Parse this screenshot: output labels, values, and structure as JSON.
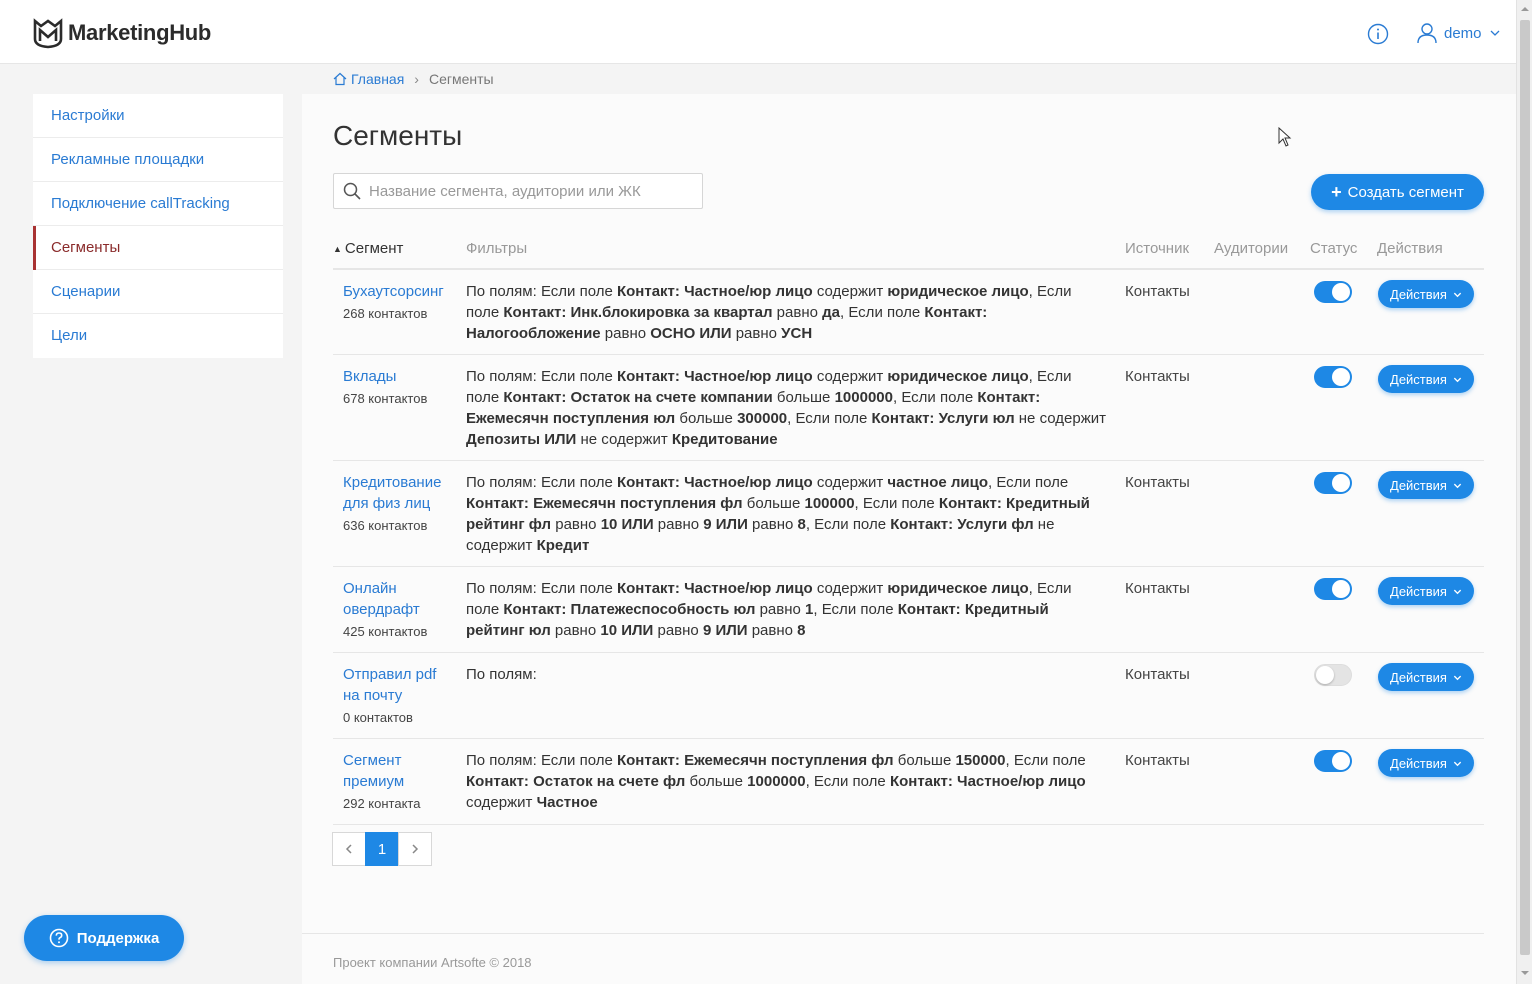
{
  "header": {
    "app_name": "MarketingHub",
    "user": "demo"
  },
  "breadcrumb": {
    "home": "Главная",
    "current": "Сегменты"
  },
  "sidebar": {
    "items": [
      {
        "label": "Настройки"
      },
      {
        "label": "Рекламные площадки"
      },
      {
        "label": "Подключение callTracking"
      },
      {
        "label": "Сегменты"
      },
      {
        "label": "Сценарии"
      },
      {
        "label": "Цели"
      }
    ],
    "active_index": 3
  },
  "support": {
    "label": "Поддержка"
  },
  "page": {
    "title": "Сегменты",
    "search_placeholder": "Название сегмента, аудитории или ЖК",
    "create_label": "Создать сегмент"
  },
  "table": {
    "columns": {
      "segment": "Сегмент",
      "filters": "Фильтры",
      "source": "Источник",
      "audiences": "Аудитории",
      "status": "Статус",
      "actions": "Действия"
    },
    "action_label": "Действия",
    "rows": [
      {
        "name": "Бухаутсорсинг",
        "count": "268 контактов",
        "filter_parts": [
          [
            "По полям: Если поле ",
            false
          ],
          [
            "Контакт: Частное/юр лицо",
            true
          ],
          [
            " содержит ",
            false
          ],
          [
            "юридическое лицо",
            true
          ],
          [
            ", Если поле ",
            false
          ],
          [
            "Контакт: Инк.блокировка за квартал",
            true
          ],
          [
            " равно ",
            false
          ],
          [
            "да",
            true
          ],
          [
            ", Если поле ",
            false
          ],
          [
            "Контакт: Налогообложение",
            true
          ],
          [
            " равно ",
            false
          ],
          [
            "ОСНО ИЛИ",
            true
          ],
          [
            " равно ",
            false
          ],
          [
            "УСН",
            true
          ]
        ],
        "source": "Контакты",
        "status_on": true
      },
      {
        "name": "Вклады",
        "count": "678 контактов",
        "filter_parts": [
          [
            "По полям: Если поле ",
            false
          ],
          [
            "Контакт: Частное/юр лицо",
            true
          ],
          [
            " содержит ",
            false
          ],
          [
            "юридическое лицо",
            true
          ],
          [
            ", Если поле ",
            false
          ],
          [
            "Контакт: Остаток на счете компании",
            true
          ],
          [
            " больше ",
            false
          ],
          [
            "1000000",
            true
          ],
          [
            ", Если поле ",
            false
          ],
          [
            "Контакт: Ежемесячн поступления юл",
            true
          ],
          [
            " больше ",
            false
          ],
          [
            "300000",
            true
          ],
          [
            ", Если поле ",
            false
          ],
          [
            "Контакт: Услуги юл",
            true
          ],
          [
            " не содержит ",
            false
          ],
          [
            "Депозиты ИЛИ",
            true
          ],
          [
            " не содержит ",
            false
          ],
          [
            "Кредитование",
            true
          ]
        ],
        "source": "Контакты",
        "status_on": true
      },
      {
        "name": "Кредитование для физ лиц",
        "count": "636 контактов",
        "filter_parts": [
          [
            "По полям: Если поле ",
            false
          ],
          [
            "Контакт: Частное/юр лицо",
            true
          ],
          [
            " содержит ",
            false
          ],
          [
            "частное лицо",
            true
          ],
          [
            ", Если поле ",
            false
          ],
          [
            "Контакт: Ежемесячн поступления фл",
            true
          ],
          [
            " больше ",
            false
          ],
          [
            "100000",
            true
          ],
          [
            ", Если поле ",
            false
          ],
          [
            "Контакт: Кредитный рейтинг фл",
            true
          ],
          [
            " равно ",
            false
          ],
          [
            "10 ИЛИ",
            true
          ],
          [
            " равно ",
            false
          ],
          [
            "9 ИЛИ",
            true
          ],
          [
            " равно ",
            false
          ],
          [
            "8",
            true
          ],
          [
            ", Если поле ",
            false
          ],
          [
            "Контакт: Услуги фл",
            true
          ],
          [
            " не содержит ",
            false
          ],
          [
            "Кредит",
            true
          ]
        ],
        "source": "Контакты",
        "status_on": true
      },
      {
        "name": "Онлайн овердрафт",
        "count": "425 контактов",
        "filter_parts": [
          [
            "По полям: Если поле ",
            false
          ],
          [
            "Контакт: Частное/юр лицо",
            true
          ],
          [
            " содержит ",
            false
          ],
          [
            "юридическое лицо",
            true
          ],
          [
            ", Если поле ",
            false
          ],
          [
            "Контакт: Платежеспособность юл",
            true
          ],
          [
            " равно ",
            false
          ],
          [
            "1",
            true
          ],
          [
            ", Если поле ",
            false
          ],
          [
            "Контакт: Кредитный рейтинг юл",
            true
          ],
          [
            " равно ",
            false
          ],
          [
            "10 ИЛИ",
            true
          ],
          [
            " равно ",
            false
          ],
          [
            "9 ИЛИ",
            true
          ],
          [
            " равно ",
            false
          ],
          [
            "8",
            true
          ]
        ],
        "source": "Контакты",
        "status_on": true
      },
      {
        "name": "Отправил pdf на почту",
        "count": "0 контактов",
        "filter_parts": [
          [
            "По полям:",
            false
          ]
        ],
        "source": "Контакты",
        "status_on": false
      },
      {
        "name": "Сегмент премиум",
        "count": "292 контакта",
        "filter_parts": [
          [
            "По полям: Если поле ",
            false
          ],
          [
            "Контакт: Ежемесячн поступления фл",
            true
          ],
          [
            " больше ",
            false
          ],
          [
            "150000",
            true
          ],
          [
            ", Если поле ",
            false
          ],
          [
            "Контакт: Остаток на счете фл",
            true
          ],
          [
            " больше ",
            false
          ],
          [
            "1000000",
            true
          ],
          [
            ", Если поле ",
            false
          ],
          [
            "Контакт: Частное/юр лицо",
            true
          ],
          [
            " содержит ",
            false
          ],
          [
            "Частное",
            true
          ]
        ],
        "source": "Контакты",
        "status_on": true
      }
    ]
  },
  "pagination": {
    "current": "1"
  },
  "footer": {
    "text": "Проект компании Artsofte © 2018"
  },
  "colors": {
    "accent": "#1e88e5",
    "link": "#2a7bd3",
    "active_marker": "#a83232"
  },
  "icons": [
    "marketinghub-logo-icon",
    "info-icon",
    "user-icon",
    "chevron-down-icon",
    "home-icon",
    "search-icon",
    "plus-icon",
    "question-icon",
    "chevron-left-icon",
    "chevron-right-icon"
  ]
}
